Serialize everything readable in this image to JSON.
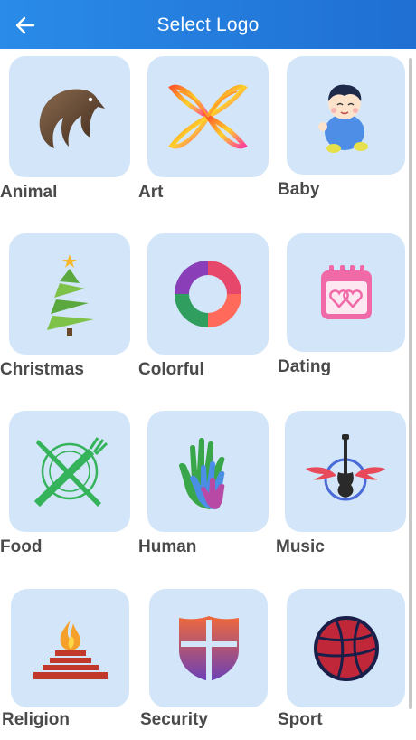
{
  "header": {
    "title": "Select Logo",
    "back_icon": "arrow-left-icon"
  },
  "categories": [
    {
      "label": "Animal",
      "icon": "eagle-icon"
    },
    {
      "label": "Art",
      "icon": "butterfly-icon"
    },
    {
      "label": "Baby",
      "icon": "baby-icon"
    },
    {
      "label": "Christmas",
      "icon": "christmas-tree-icon"
    },
    {
      "label": "Colorful",
      "icon": "colorful-ring-icon"
    },
    {
      "label": "Dating",
      "icon": "calendar-hearts-icon"
    },
    {
      "label": "Food",
      "icon": "fork-knife-plate-icon"
    },
    {
      "label": "Human",
      "icon": "hands-icon"
    },
    {
      "label": "Music",
      "icon": "winged-guitar-icon"
    },
    {
      "label": "Religion",
      "icon": "altar-flame-icon"
    },
    {
      "label": "Security",
      "icon": "shield-icon"
    },
    {
      "label": "Sport",
      "icon": "basketball-icon"
    }
  ],
  "colors": {
    "appbar": "#1f78dc",
    "card": "#d3e6f9",
    "label": "#4a4a4a"
  }
}
